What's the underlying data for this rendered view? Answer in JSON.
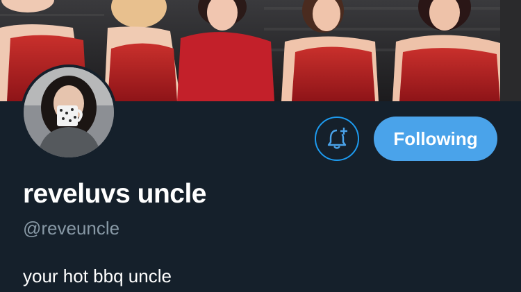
{
  "profile": {
    "display_name": "reveluvs uncle",
    "handle": "@reveuncle",
    "bio": "your hot bbq uncle"
  },
  "actions": {
    "notifications_icon": "bell-plus-icon",
    "follow_label": "Following"
  },
  "colors": {
    "background": "#15202b",
    "accent": "#4aa3ea",
    "secondary_text": "#8899a6"
  }
}
